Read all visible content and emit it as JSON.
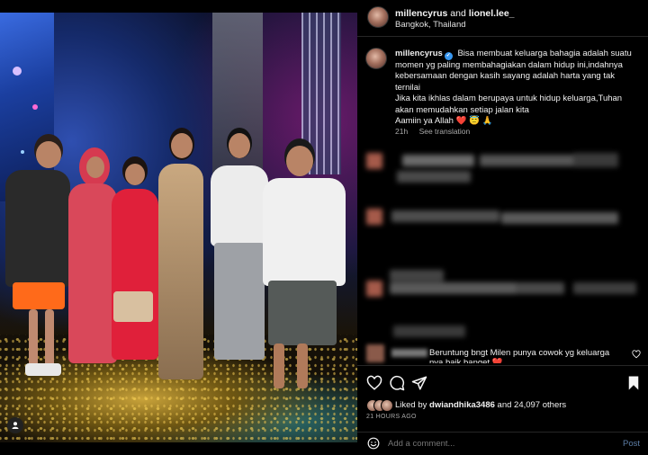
{
  "post": {
    "header": {
      "user1": "millencyrus",
      "connector": "and",
      "user2": "lionel.lee_",
      "location": "Bangkok, Thailand"
    },
    "caption": {
      "username": "millencyrus",
      "line1": "Bisa membuat keluarga bahagia adalah suatu momen yg paling membahagiakan dalam hidup ini,indahnya kebersamaan dengan kasih sayang adalah harta yang tak ternilai",
      "line2": "Jika kita ikhlas dalam berupaya untuk hidup keluarga,Tuhan akan memudahkan setiap jalan kita",
      "line3": "Aamiin ya Allah ❤️ 😇 🙏",
      "age": "21h",
      "see_translation": "See translation"
    },
    "last_comment": {
      "text_line1": "Beruntung bngt Milen punya cowok yg keluarga",
      "text_line2": "nya baik banget ❤️"
    },
    "likes": {
      "prefix": "Liked by",
      "user": "dwiandhika3486",
      "suffix": "and 24,097 others"
    },
    "timestamp": "21 HOURS AGO",
    "comment_box": {
      "placeholder": "Add a comment...",
      "post_label": "Post"
    },
    "icons": {
      "like": "heart-icon",
      "comment": "comment-icon",
      "share": "share-icon",
      "save": "bookmark-icon",
      "emoji": "emoji-icon",
      "tag": "user-tag-icon"
    },
    "colors": {
      "background": "#000000",
      "verified": "#3897f0",
      "muted_text": "#a8a8a8",
      "post_button": "#5d7ea6"
    }
  }
}
